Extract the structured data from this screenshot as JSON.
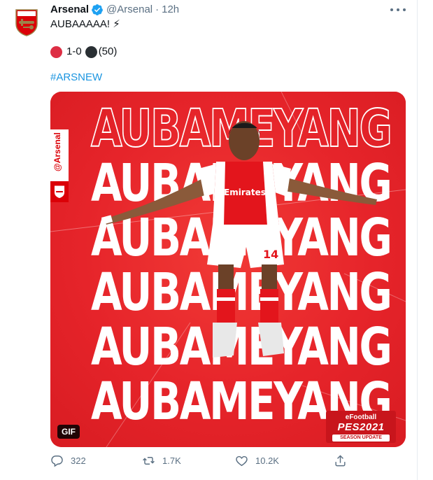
{
  "tweet": {
    "display_name": "Arsenal",
    "handle": "@Arsenal",
    "separator": "·",
    "time": "12h",
    "text": "AUBAAAAA! ⚡",
    "score_left": "1-0",
    "score_right": "(50)",
    "hashtag": "#ARSNEW"
  },
  "media": {
    "banner_word": "AUBAMEYANG",
    "side_badge": "@Arsenal",
    "gif_label": "GIF",
    "pes_top": "eFootball",
    "pes_main": "PES2021",
    "pes_sub": "SEASON UPDATE",
    "accent_color": "#e6242a"
  },
  "actions": {
    "replies": "322",
    "retweets": "1.7K",
    "likes": "10.2K"
  },
  "icons": {
    "verified": "verified-badge-icon",
    "more": "more-icon",
    "reply": "reply-icon",
    "retweet": "retweet-icon",
    "like": "heart-icon",
    "share": "share-icon"
  },
  "colors": {
    "link": "#1b95e0",
    "secondary_text": "#5b7083",
    "verified": "#1da1f2",
    "red_ball": "#dd2e44",
    "black_ball": "#292f33"
  }
}
